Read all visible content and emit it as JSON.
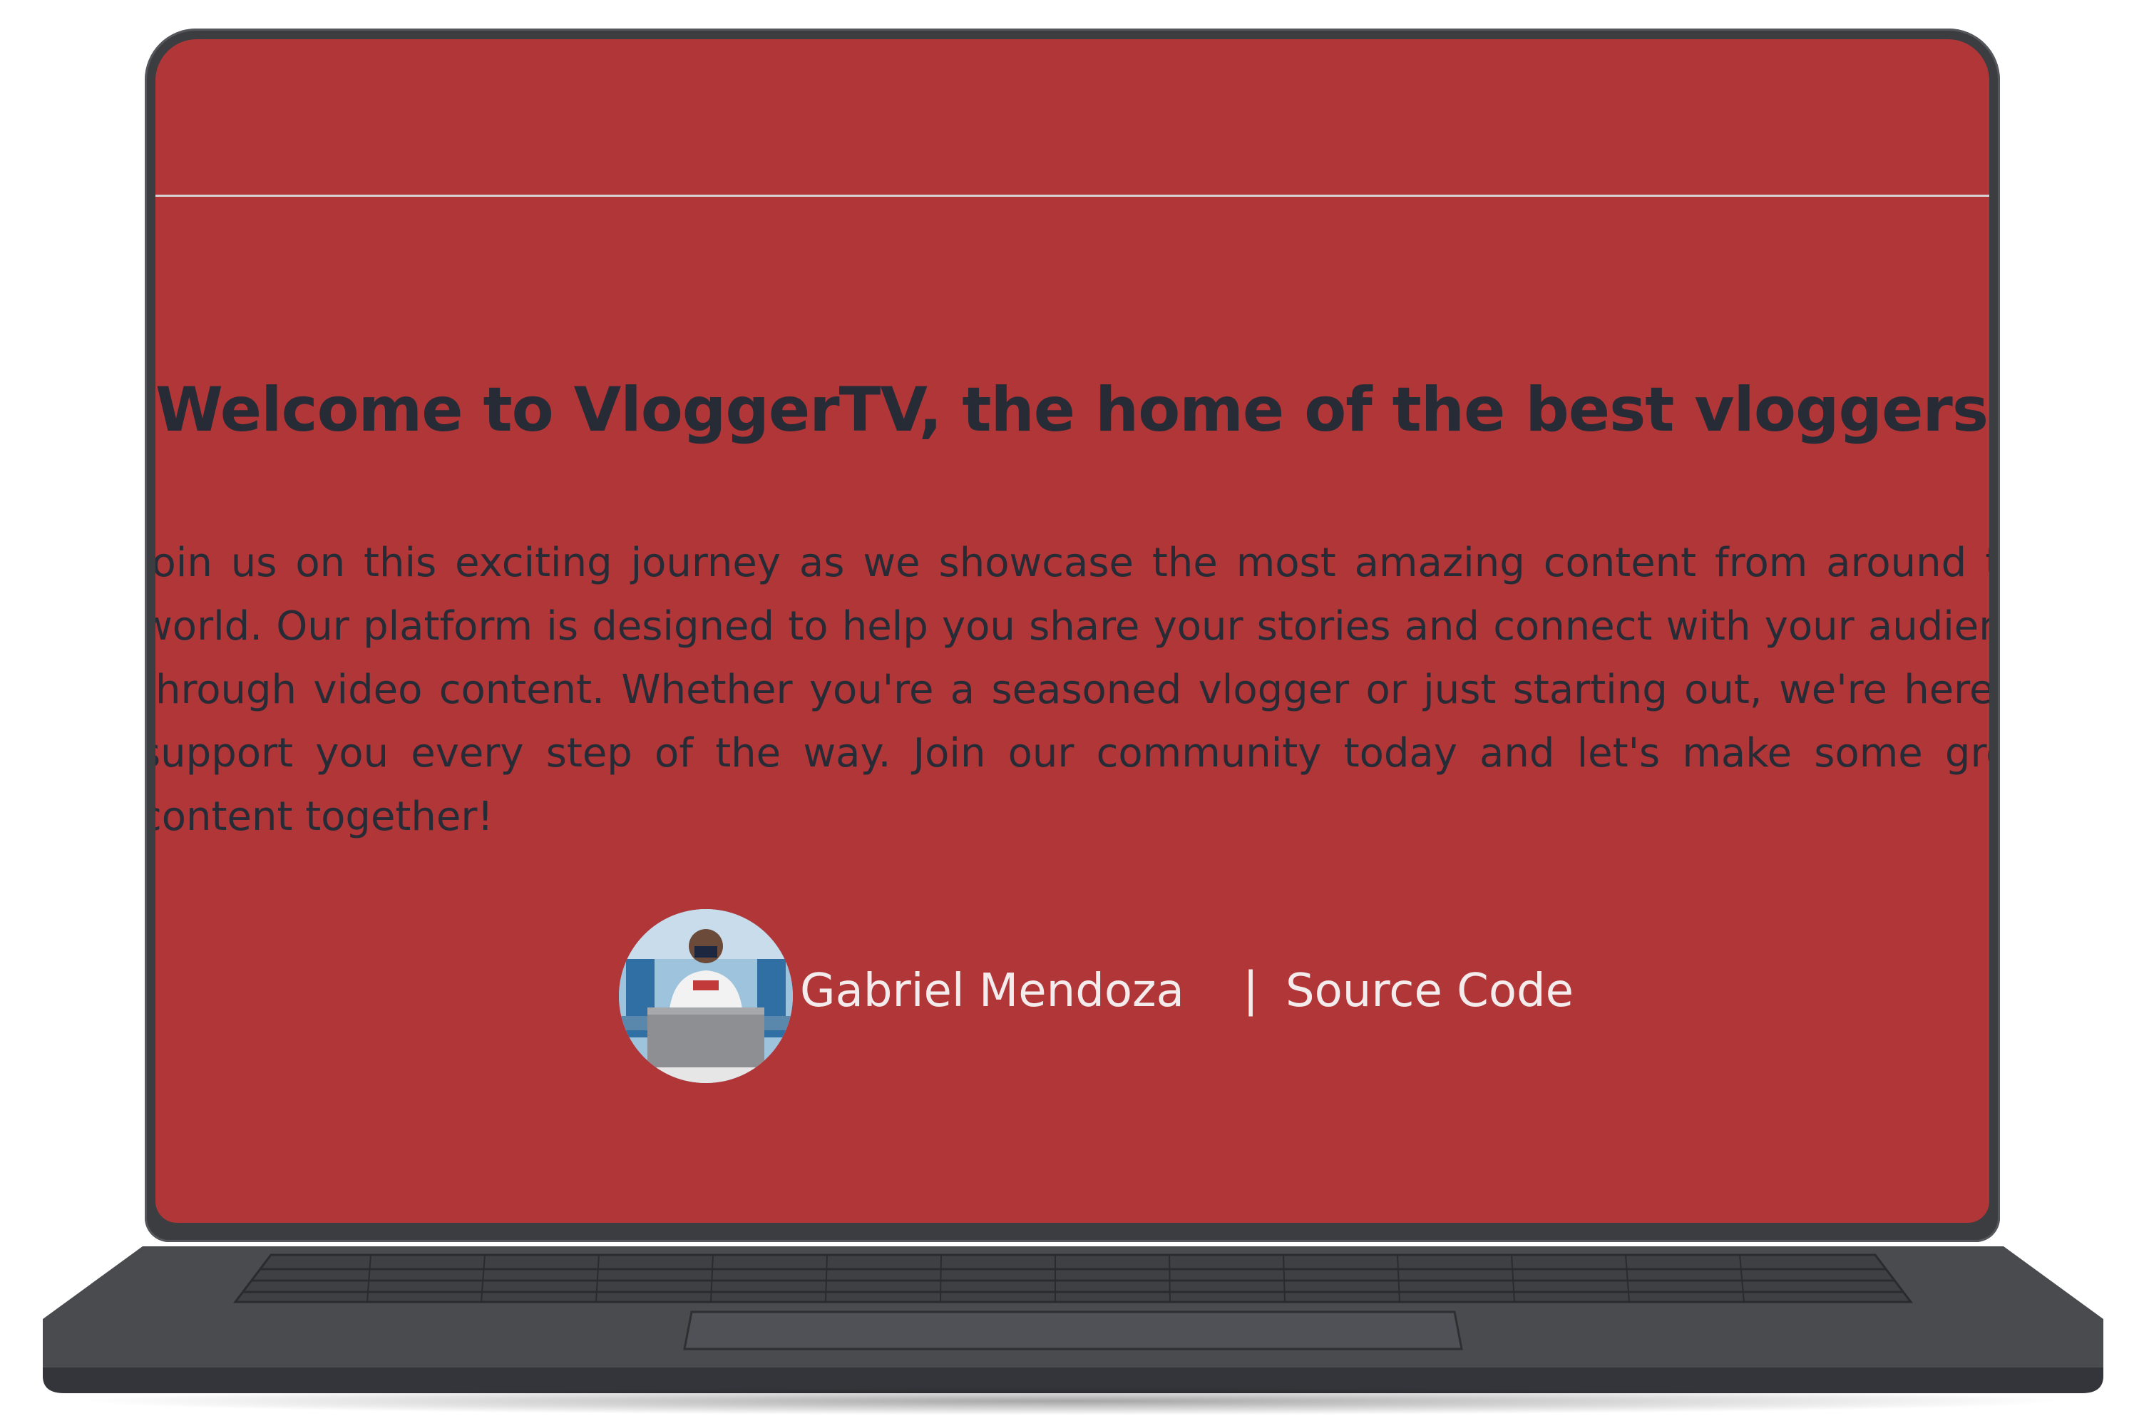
{
  "colors": {
    "screen_bg": "#b13638",
    "heading_text": "#272b36",
    "light_text": "#f4ecec",
    "bezel": "#3c3d40",
    "deck": "#4a4b4f"
  },
  "hero": {
    "title": "Welcome to VloggerTV, the home of the best vloggers.",
    "body": "Join us on this exciting journey as we showcase the most amazing content from around the world. Our platform is designed to help you share your stories and connect with your audience through video content. Whether you're a seasoned vlogger or just starting out, we're here to support you every step of the way. Join our community today and let's make some great content together!"
  },
  "author": {
    "name": "Gabriel Mendoza",
    "separator": "|",
    "source_label": "Source Code",
    "avatar_icon": "person-at-laptop-photo"
  }
}
